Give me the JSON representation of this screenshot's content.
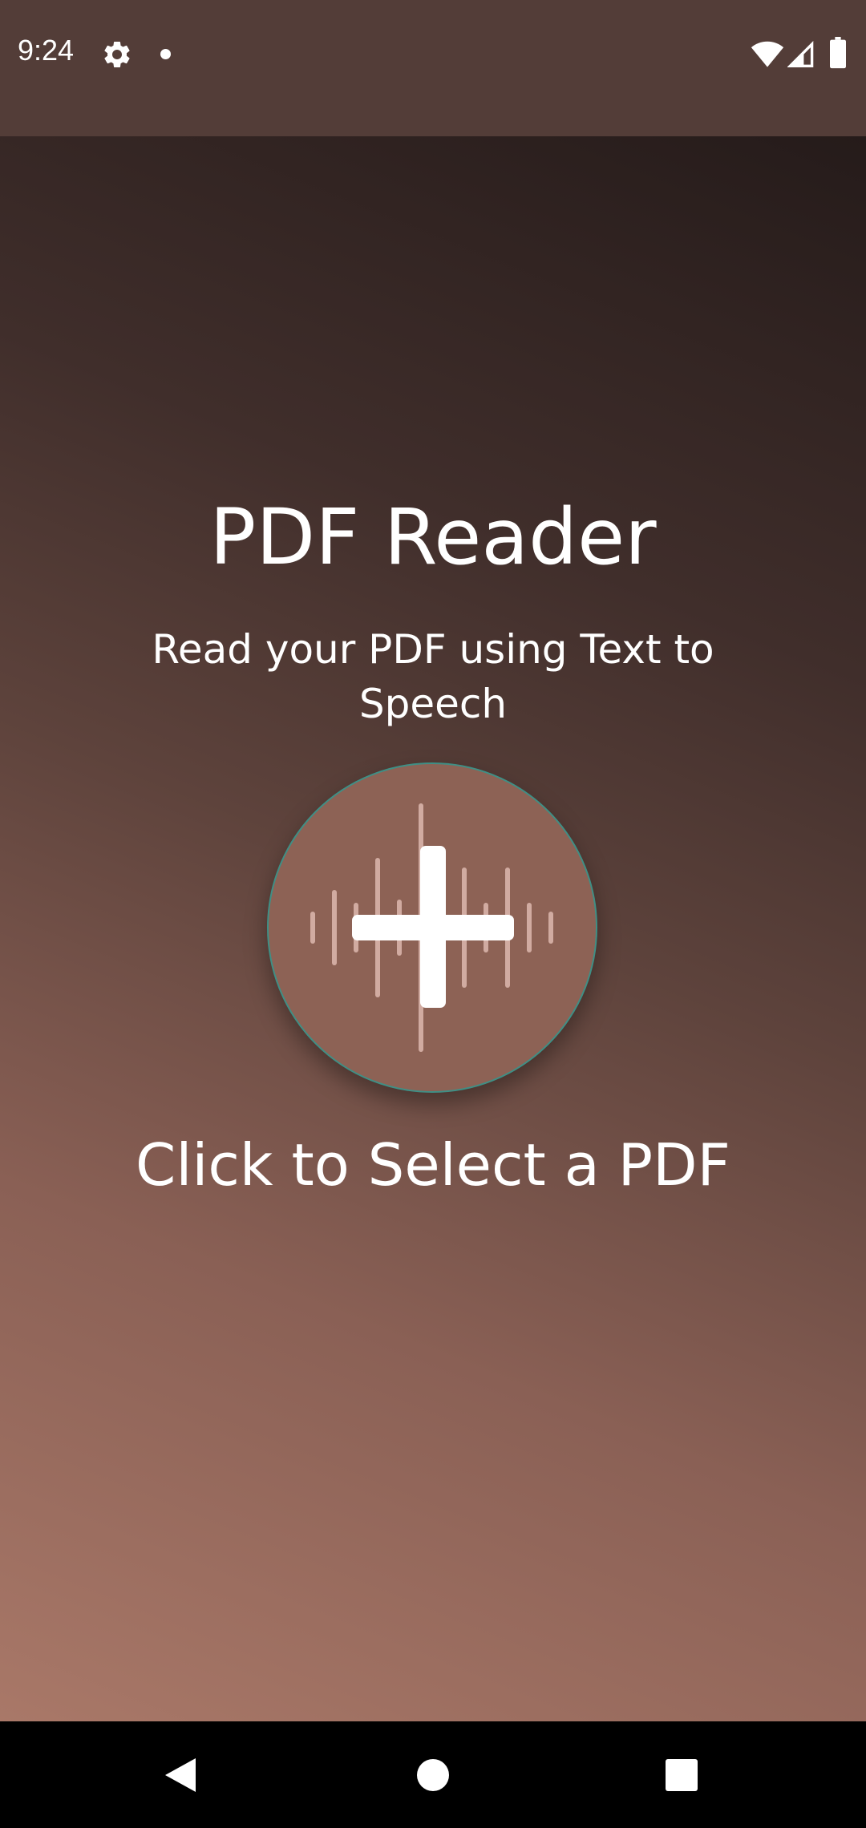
{
  "status_bar": {
    "time": "9:24",
    "icons": [
      "gear-icon",
      "notification-dot-icon",
      "wifi-icon",
      "cell-signal-icon",
      "battery-icon"
    ]
  },
  "main": {
    "title": "PDF Reader",
    "subtitle": "Read your PDF using Text to Speech",
    "select_button_icon": "add-audio-waveform-icon",
    "cta": "Click to Select a PDF"
  },
  "nav_bar": {
    "items": [
      "back-icon",
      "home-icon",
      "recents-icon"
    ]
  },
  "colors": {
    "status_bar": "#533d38",
    "gradient_light": "#a97868",
    "gradient_dark": "#251b1a",
    "button_fill": "#8d6255",
    "button_ring": "#3f8f85",
    "text": "#ffffff",
    "nav_bar": "#000000"
  }
}
